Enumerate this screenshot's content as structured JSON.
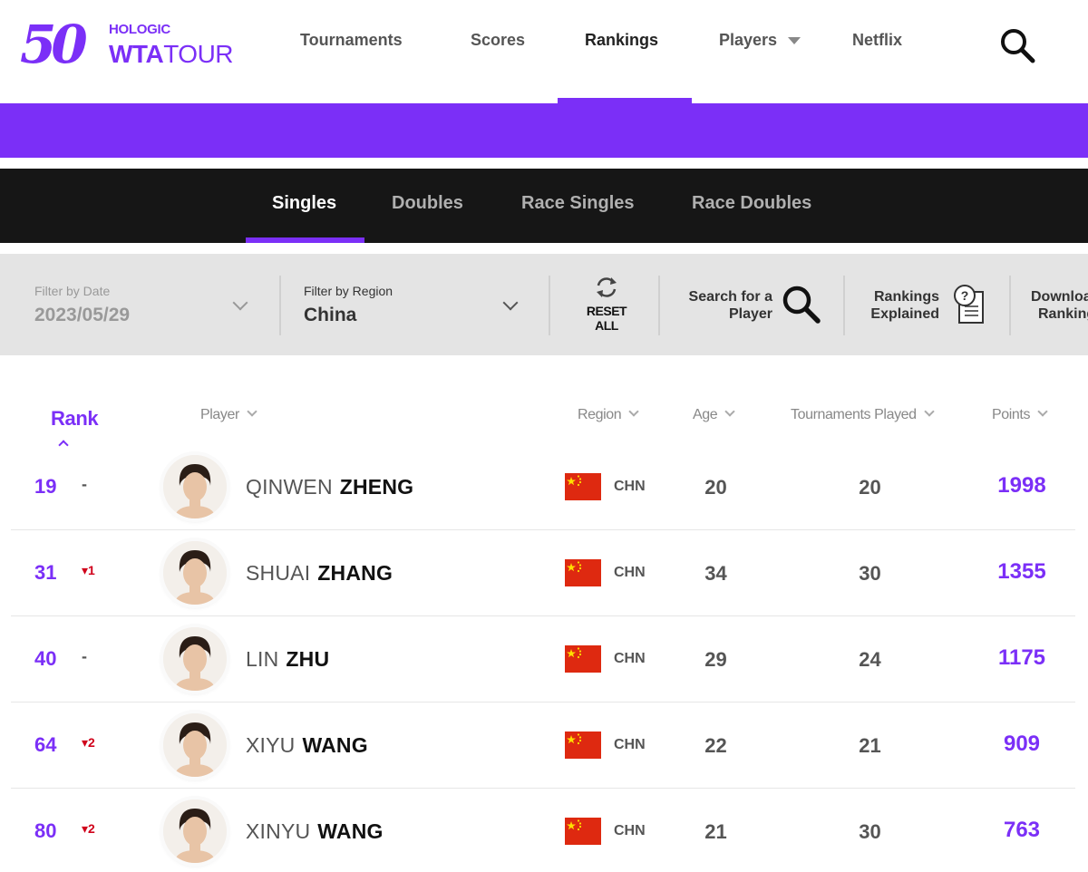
{
  "logo": {
    "fifty": "50",
    "brand_top": "HOLOGIC",
    "brand_wta": "WTA",
    "brand_tour": "TOUR"
  },
  "nav": {
    "items": [
      {
        "label": "Tournaments"
      },
      {
        "label": "Scores"
      },
      {
        "label": "Rankings"
      },
      {
        "label": "Players"
      },
      {
        "label": "Netflix"
      }
    ],
    "active": "Rankings"
  },
  "subnav": {
    "tabs": [
      {
        "label": "Singles"
      },
      {
        "label": "Doubles"
      },
      {
        "label": "Race Singles"
      },
      {
        "label": "Race Doubles"
      }
    ],
    "active": "Singles"
  },
  "filters": {
    "date_label": "Filter by Date",
    "date_value": "2023/05/29",
    "region_label": "Filter by Region",
    "region_value": "China",
    "reset_line1": "RESET",
    "reset_line2": "ALL",
    "search_line1": "Search for a",
    "search_line2": "Player",
    "explained_line1": "Rankings",
    "explained_line2": "Explained",
    "download_line1": "Download",
    "download_line2": "Rankings"
  },
  "table": {
    "headers": {
      "rank": "Rank",
      "player": "Player",
      "region": "Region",
      "age": "Age",
      "tournaments": "Tournaments Played",
      "points": "Points"
    },
    "rows": [
      {
        "rank": "19",
        "move": "-",
        "first": "QINWEN",
        "last": "ZHENG",
        "region": "CHN",
        "age": "20",
        "tournaments": "20",
        "points": "1998"
      },
      {
        "rank": "31",
        "move": "▾1",
        "first": "SHUAI",
        "last": "ZHANG",
        "region": "CHN",
        "age": "34",
        "tournaments": "30",
        "points": "1355"
      },
      {
        "rank": "40",
        "move": "-",
        "first": "LIN",
        "last": "ZHU",
        "region": "CHN",
        "age": "29",
        "tournaments": "24",
        "points": "1175"
      },
      {
        "rank": "64",
        "move": "▾2",
        "first": "XIYU",
        "last": "WANG",
        "region": "CHN",
        "age": "22",
        "tournaments": "21",
        "points": "909"
      },
      {
        "rank": "80",
        "move": "▾2",
        "first": "XINYU",
        "last": "WANG",
        "region": "CHN",
        "age": "21",
        "tournaments": "30",
        "points": "763"
      }
    ]
  },
  "colors": {
    "accent": "#7b2ff7",
    "subnav_bg": "#161616",
    "filter_bg": "#e4e4e4",
    "drop_red": "#d0021b",
    "flag_red": "#de2910",
    "flag_yellow": "#ffde00"
  }
}
